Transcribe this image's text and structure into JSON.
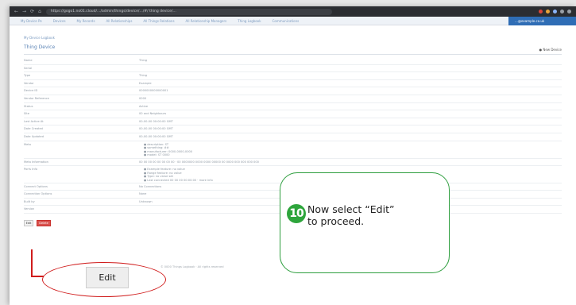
{
  "browser": {
    "nav_glyphs": [
      "←",
      "→",
      "⟳",
      "⌂"
    ],
    "url": "https://gogo1.no01.cloud/…/admin/things/device/…/#/ thing device/…",
    "extension_colors": [
      "#d9453a",
      "#e8a43a",
      "#8ab4f8",
      "#9aa0a6",
      "#9aa0a6"
    ]
  },
  "appnav": {
    "items": [
      "My Device Pe",
      "Devices",
      "My Records",
      "All Relationships",
      "All Things Relations",
      "All Relationship Managers",
      "Thing Logbook",
      "Communications"
    ],
    "account": "…@example.co.uk"
  },
  "breadcrumb": "My Device Logbook",
  "page_title": "Thing Device",
  "new_device": "● New Device",
  "rows": [
    {
      "k": "Name",
      "v": "Thing"
    },
    {
      "k": "Serial",
      "v": ""
    },
    {
      "k": "Type",
      "v": "Thing"
    },
    {
      "k": "Vendor",
      "v": "Example"
    },
    {
      "k": "Device ID",
      "v": "0000000000000001"
    },
    {
      "k": "Vendor Reference",
      "v": "0000"
    },
    {
      "k": "Status",
      "v": "Active"
    },
    {
      "k": "Site",
      "v": "00 and Neighbours"
    },
    {
      "k": "Last Active At",
      "v": "00-00-00 00:00:00 GMT"
    },
    {
      "k": "Date Created",
      "v": "00-00-00 00:00:00 GMT"
    },
    {
      "k": "Date Updated",
      "v": "00-00-00 00:00:00 GMT"
    }
  ],
  "meta_row": {
    "k": "Meta",
    "items": [
      "● description: ST",
      "● something: ##",
      "● manufacturer: 0000-0000-0000",
      "● model: ST 0000"
    ]
  },
  "info_row": {
    "k": "Meta Information",
    "v": "00 00 00 00 00 00 00 00 · 00 0000000 0000 0000 00000 00 0000 000 000 000 000"
  },
  "ports_row": {
    "k": "Ports Info",
    "items": [
      "● Example feature: no value",
      "● Range feature: no value",
      "● Type: no value set",
      "● Last connected 00 00 00 00:00:00 · more info"
    ]
  },
  "extra_rows": [
    {
      "k": "Connect Options",
      "v": "No Connections"
    },
    {
      "k": "Connection Options",
      "v": "None"
    },
    {
      "k": "Built by",
      "v": "Unknown"
    },
    {
      "k": "Version",
      "v": ""
    }
  ],
  "buttons": {
    "edit_small": "Edit",
    "delete": "Delete"
  },
  "footer": "© 0000 Things Logbook · All rights reserved",
  "annotation": {
    "edit_zoom": "Edit",
    "step_number": "10",
    "tip_line1": "Now select “Edit”",
    "tip_line2": "to proceed."
  },
  "colors": {
    "accent": "#2f6db5",
    "tip_border": "#2e9e3e",
    "badge": "#2ea53c",
    "highlight": "#d01c1c",
    "delete": "#d9534f"
  }
}
